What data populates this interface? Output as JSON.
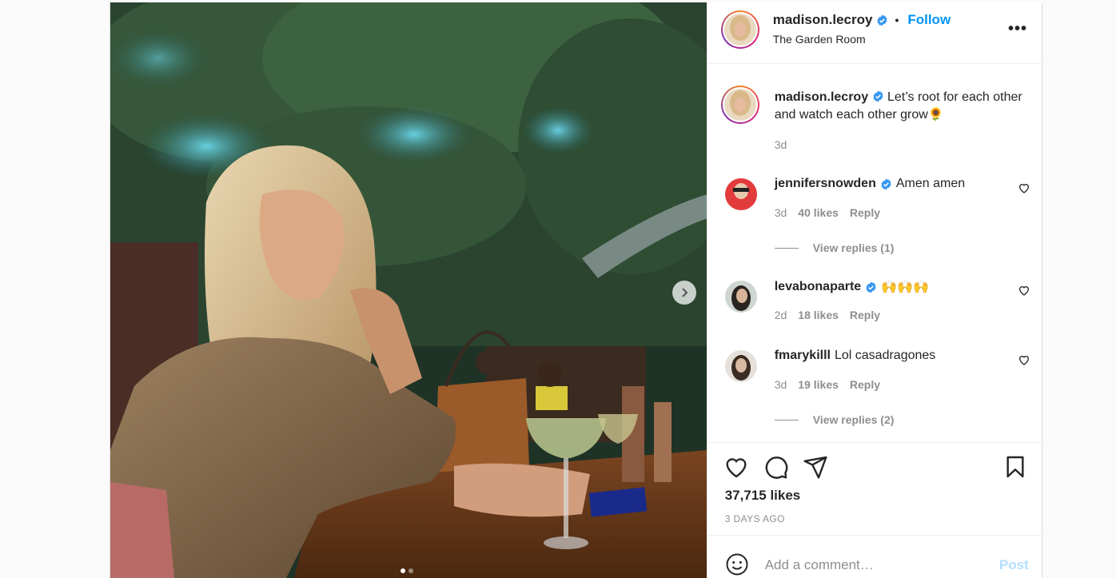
{
  "header": {
    "username": "madison.lecroy",
    "bullet": "•",
    "follow_label": "Follow",
    "location": "The Garden Room",
    "more_label": "•••"
  },
  "caption": {
    "username": "madison.lecroy",
    "text": "Let’s root for each other and watch each other grow🌻",
    "time": "3d"
  },
  "comments": [
    {
      "username": "jennifersnowden",
      "verified": true,
      "text": "Amen amen",
      "time": "3d",
      "likes": "40 likes",
      "reply": "Reply",
      "view_replies": "View replies (1)"
    },
    {
      "username": "levabonaparte",
      "verified": true,
      "text": "🙌🙌🙌",
      "time": "2d",
      "likes": "18 likes",
      "reply": "Reply"
    },
    {
      "username": "fmarykilll",
      "verified": false,
      "text": "Lol casadragones",
      "time": "3d",
      "likes": "19 likes",
      "reply": "Reply",
      "view_replies": "View replies (2)"
    }
  ],
  "actions": {
    "likes": "37,715 likes",
    "ago": "3 DAYS AGO"
  },
  "add_comment": {
    "placeholder": "Add a comment…",
    "post_label": "Post"
  },
  "carousel": {
    "total": 2,
    "active": 1
  },
  "colors": {
    "accent": "#0095f6",
    "verified": "#3897f0",
    "muted": "#8e8e8e",
    "post_disabled": "#b2dffc"
  },
  "icons": [
    "chevron-right-icon",
    "verified-badge-icon",
    "heart-icon",
    "comment-icon",
    "share-icon",
    "bookmark-icon",
    "smiley-icon"
  ]
}
